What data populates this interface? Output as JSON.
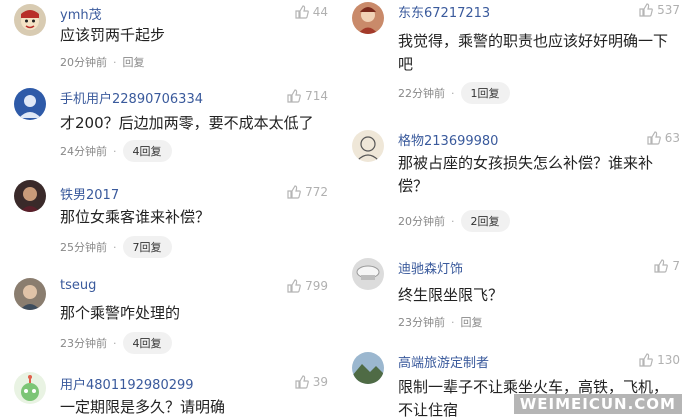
{
  "left": [
    {
      "user": "ymh茂",
      "likes": "44",
      "text": "应该罚两千起步",
      "time": "20分钟前",
      "reply": "回复",
      "reply_pill": false,
      "avatar": "opera-mask-icon"
    },
    {
      "user": "手机用户22890706334",
      "likes": "714",
      "text": "才200？后边加两零，要不成本太低了",
      "time": "24分钟前",
      "reply": "4回复",
      "reply_pill": true,
      "avatar": "default-avatar-icon"
    },
    {
      "user": "铁男2017",
      "likes": "772",
      "text": "那位女乘客谁来补偿？",
      "time": "25分钟前",
      "reply": "7回复",
      "reply_pill": true,
      "avatar": "photo-avatar-icon"
    },
    {
      "user": "tseug",
      "likes": "799",
      "text": "那个乘警咋处理的",
      "time": "23分钟前",
      "reply": "4回复",
      "reply_pill": true,
      "avatar": "photo-avatar-icon"
    },
    {
      "user": "用户4801192980299",
      "likes": "39",
      "text": "一定期限是多久？请明确",
      "time": "",
      "reply": "",
      "reply_pill": false,
      "avatar": "cartoon-avatar-icon"
    }
  ],
  "right": [
    {
      "user": "东东67217213",
      "likes": "537",
      "text": "我觉得，乘警的职责也应该好好明确一下吧",
      "time": "22分钟前",
      "reply": "1回复",
      "reply_pill": true,
      "avatar": "photo-avatar-icon"
    },
    {
      "user": "格物213699980",
      "likes": "63",
      "text": "那被占座的女孩损失怎么补偿？谁来补偿？",
      "time": "20分钟前",
      "reply": "2回复",
      "reply_pill": true,
      "avatar": "sketch-avatar-icon"
    },
    {
      "user": "迪驰森灯饰",
      "likes": "7",
      "text": "终生限坐限飞？",
      "time": "23分钟前",
      "reply": "回复",
      "reply_pill": false,
      "avatar": "lamp-avatar-icon"
    },
    {
      "user": "高端旅游定制者",
      "likes": "130",
      "text": "限制一辈子不让乘坐火车，高铁，飞机，不让住宿",
      "time": "",
      "reply": "",
      "reply_pill": false,
      "avatar": "landscape-avatar-icon"
    }
  ],
  "watermark": "WEIMEICUN.COM"
}
